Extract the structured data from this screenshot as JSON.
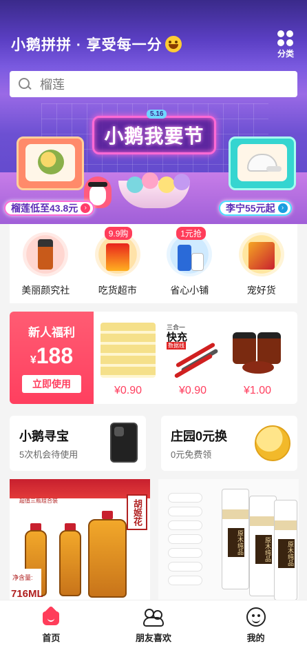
{
  "header": {
    "title": "小鹅拼拼 · 享受每一分",
    "emoji_icon": "grinning-face-icon",
    "category_label": "分类"
  },
  "search": {
    "placeholder": "榴莲"
  },
  "banner": {
    "festival_date": "5.16",
    "festival_title": "小鹅我要节",
    "promo_left": "榴莲低至43.8元",
    "promo_right": "李宁55元起"
  },
  "categories": [
    {
      "label": "美丽颜究社",
      "badge": ""
    },
    {
      "label": "吃货超市",
      "badge": "9.9购"
    },
    {
      "label": "省心小铺",
      "badge": "1元抢"
    },
    {
      "label": "宠好货",
      "badge": ""
    }
  ],
  "newcomer": {
    "title": "新人福利",
    "currency": "¥",
    "amount": "188",
    "button": "立即使用",
    "products": [
      {
        "price": "¥0.90",
        "image": "tissue-boxes"
      },
      {
        "price": "¥0.90",
        "image": "charging-cables",
        "overlay_top": "三合一",
        "overlay_main": "快充",
        "overlay_tag": "数据线"
      },
      {
        "price": "¥1.00",
        "image": "sauce-jars"
      }
    ]
  },
  "cards": {
    "left": {
      "title": "小鹅寻宝",
      "subtitle": "5次机会待使用"
    },
    "right": {
      "title": "庄园0元换",
      "subtitle": "0元免费领"
    }
  },
  "tiles": {
    "left": {
      "caption": "超值三瓶组合装",
      "brand": "胡姬花",
      "volume_label": "净含量:",
      "volume": "716ML"
    },
    "right": {
      "pack_label": "原木纯品"
    }
  },
  "nav": [
    {
      "label": "首页",
      "icon": "home-icon",
      "active": true
    },
    {
      "label": "朋友喜欢",
      "icon": "friends-icon",
      "active": false
    },
    {
      "label": "我的",
      "icon": "profile-icon",
      "active": false
    }
  ],
  "colors": {
    "accent": "#ff3d5a",
    "banner_purple": "#6c50d2"
  }
}
